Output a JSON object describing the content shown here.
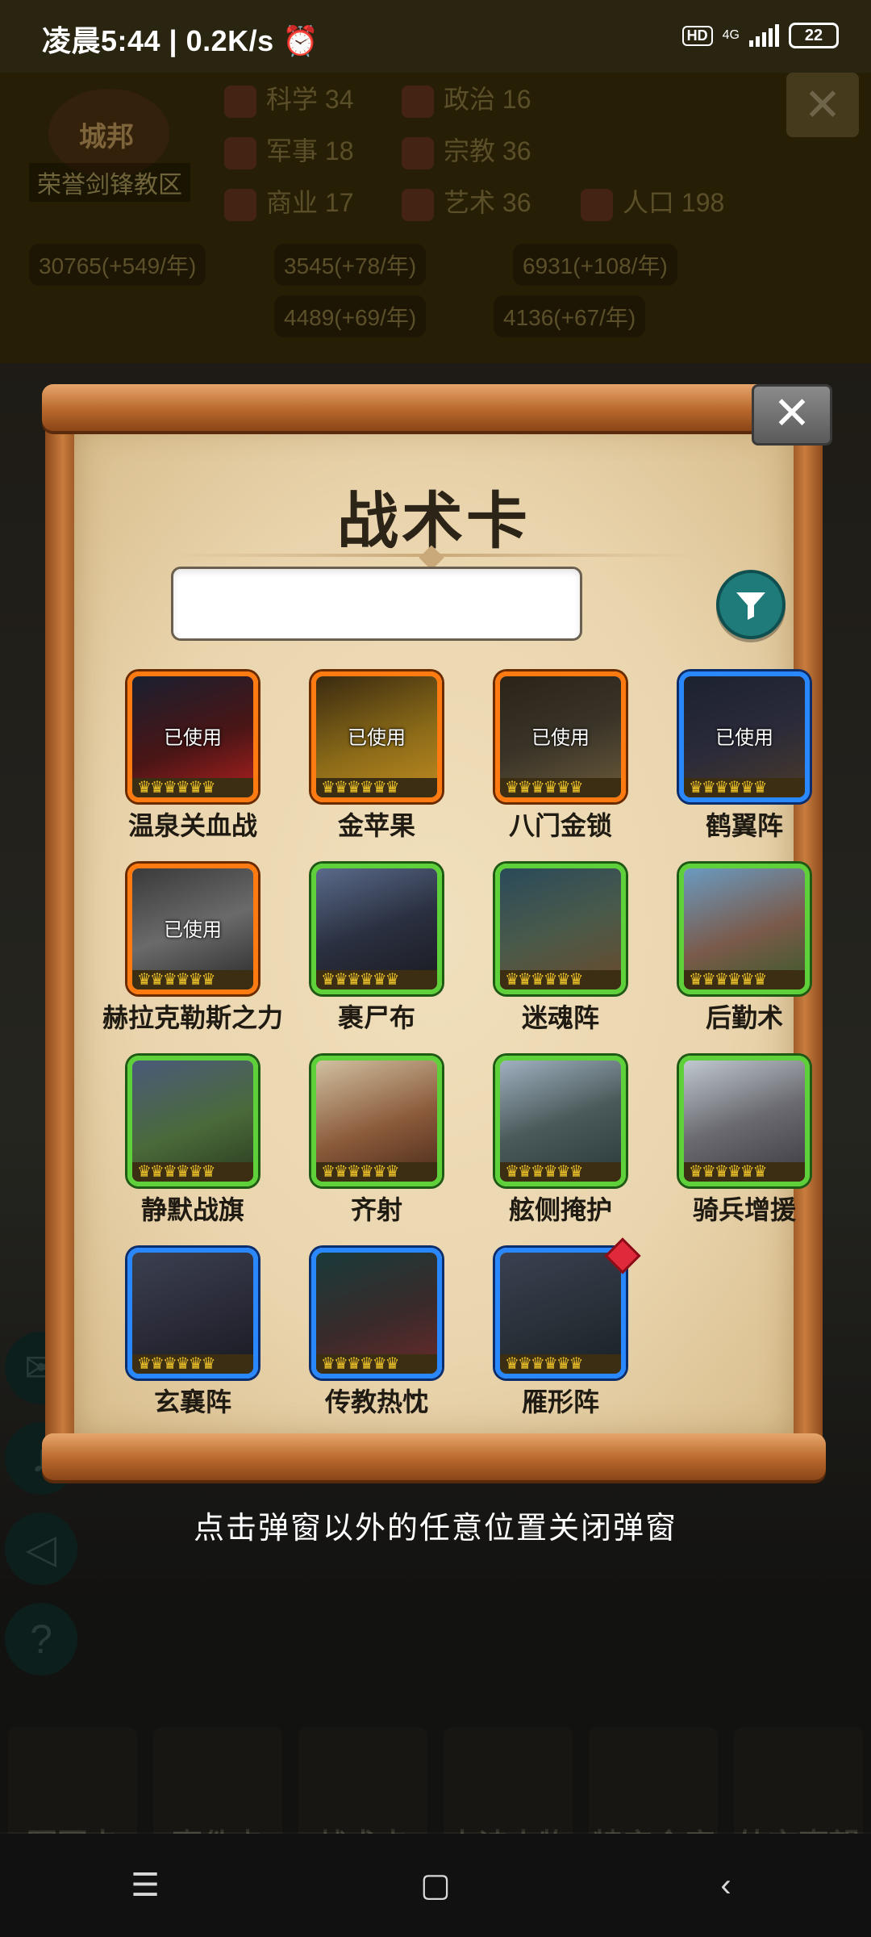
{
  "status": {
    "time": "凌晨5:44 | 0.2K/s ⏰",
    "hd": "HD",
    "network": "4G",
    "battery": "22"
  },
  "background": {
    "city_tag": "城邦",
    "city_name": "荣誉剑锋教区",
    "stats": [
      {
        "label": "科学 34"
      },
      {
        "label": "政治 16"
      },
      {
        "label": "军事 18"
      },
      {
        "label": "宗教 36"
      },
      {
        "label": "商业 17"
      },
      {
        "label": "艺术 36"
      },
      {
        "label": "人口 198"
      }
    ],
    "resources": [
      "30765(+549/年)",
      "3545(+78/年)",
      "6931(+108/年)",
      "4489(+69/年)",
      "4136(+67/年)"
    ],
    "bottom_nav": [
      "军团卡",
      "事件卡",
      "战术卡",
      "史诗人物",
      "特产仓库",
      "外交声望"
    ]
  },
  "popup": {
    "title": "战术卡",
    "close_icon": "close-icon",
    "search_value": "",
    "filter_icon": "filter-icon",
    "used_label": "已使用",
    "cards": [
      {
        "name": "温泉关血战",
        "rarity": "orange",
        "used": true,
        "crowns": "♛♛♛♛♛♛"
      },
      {
        "name": "金苹果",
        "rarity": "orange",
        "used": true,
        "crowns": "♛♛♛♛♛♛"
      },
      {
        "name": "八门金锁",
        "rarity": "orange",
        "used": true,
        "crowns": "♛♛♛♛♛♛"
      },
      {
        "name": "鹤翼阵",
        "rarity": "blue",
        "used": true,
        "crowns": "♛♛♛♛♛♛"
      },
      {
        "name": "赫拉克勒斯之力",
        "rarity": "orange",
        "used": true,
        "crowns": "♛♛♛♛♛♛"
      },
      {
        "name": "裹尸布",
        "rarity": "green",
        "used": false,
        "crowns": "♛♛♛♛♛♛"
      },
      {
        "name": "迷魂阵",
        "rarity": "green",
        "used": false,
        "crowns": "♛♛♛♛♛♛"
      },
      {
        "name": "后勤术",
        "rarity": "green",
        "used": false,
        "crowns": "♛♛♛♛♛♛"
      },
      {
        "name": "静默战旗",
        "rarity": "green",
        "used": false,
        "crowns": "♛♛♛♛♛♛"
      },
      {
        "name": "齐射",
        "rarity": "green",
        "used": false,
        "crowns": "♛♛♛♛♛♛"
      },
      {
        "name": "舷侧掩护",
        "rarity": "green",
        "used": false,
        "crowns": "♛♛♛♛♛♛"
      },
      {
        "name": "骑兵增援",
        "rarity": "green",
        "used": false,
        "crowns": "♛♛♛♛♛♛"
      },
      {
        "name": "玄襄阵",
        "rarity": "blue",
        "used": false,
        "crowns": "♛♛♛♛♛♛"
      },
      {
        "name": "传教热忱",
        "rarity": "blue",
        "used": false,
        "crowns": "♛♛♛♛♛♛"
      },
      {
        "name": "雁形阵",
        "rarity": "blue",
        "used": false,
        "crowns": "♛♛♛♛♛♛",
        "new_badge": true
      }
    ]
  },
  "hint": "点击弹窗以外的任意位置关闭弹窗",
  "sysnav": {
    "menu": "☰",
    "home": "▢",
    "back": "‹"
  },
  "colors": {
    "orange": "#ff7a10",
    "blue": "#2a88ff",
    "green": "#5ed03a",
    "filter": "#1f7a7a"
  }
}
